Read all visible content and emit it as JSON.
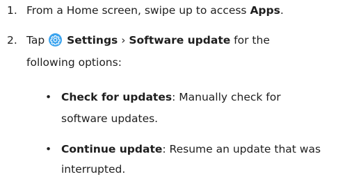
{
  "steps": [
    {
      "number": "1.",
      "text_before": "From a Home screen, swipe up to access ",
      "bold": "Apps",
      "text_after": "."
    },
    {
      "number": "2.",
      "line1_before": "Tap ",
      "icon": "settings-gear-icon",
      "bold1": "Settings",
      "sep": " › ",
      "bold2": "Software update",
      "line1_after": " for the",
      "line2": "following options:"
    }
  ],
  "bullets": [
    {
      "marker": "•",
      "bold": "Check for updates",
      "line1": ": Manually check for",
      "line2": "software updates."
    },
    {
      "marker": "•",
      "bold": "Continue update",
      "line1": ": Resume an update that was",
      "line2": "interrupted."
    }
  ],
  "icon_color": "#3aa3ee"
}
